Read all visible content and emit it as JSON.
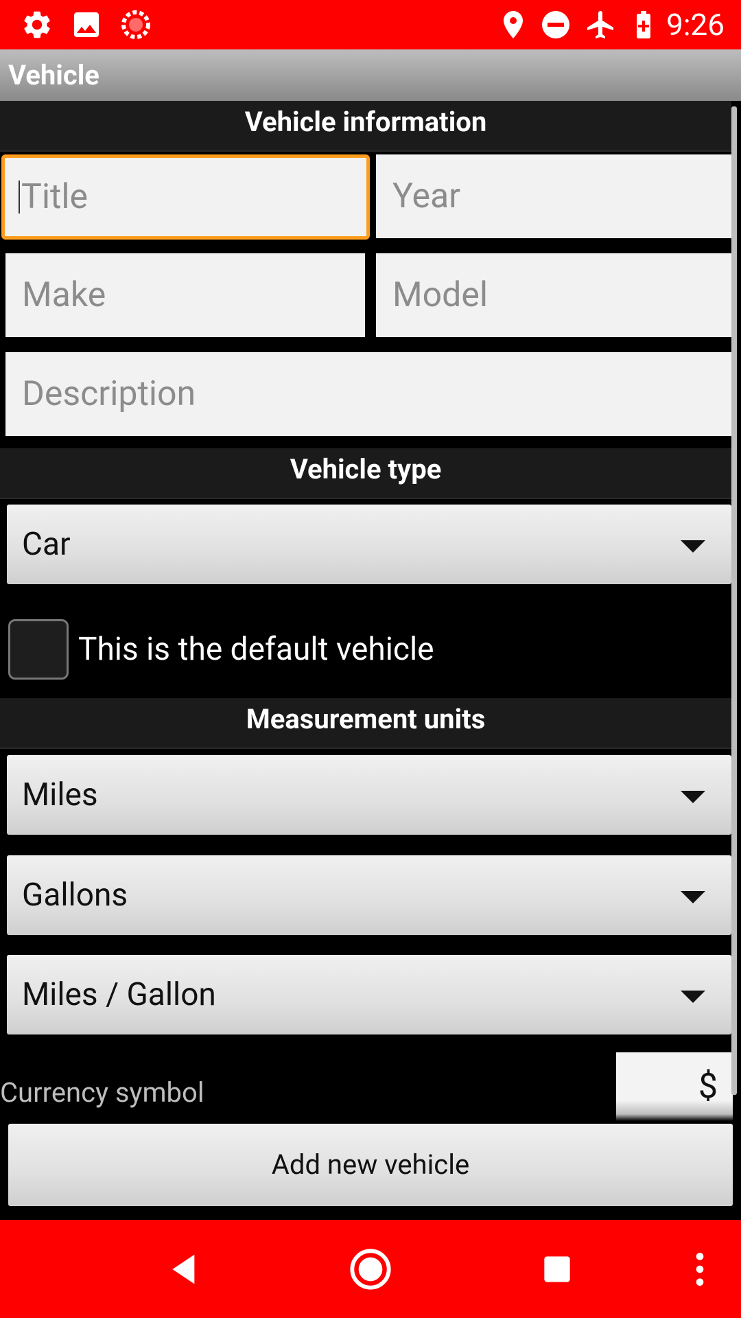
{
  "status_bar": {
    "time": "9:26",
    "left_icons": [
      "gear-icon",
      "image-icon",
      "sync-icon"
    ],
    "right_icons": [
      "location-icon",
      "do-not-disturb-icon",
      "airplane-icon",
      "battery-icon"
    ]
  },
  "app_bar": {
    "title": "Vehicle"
  },
  "sections": {
    "vehicle_information": "Vehicle information",
    "vehicle_type": "Vehicle type",
    "measurement_units": "Measurement units"
  },
  "fields": {
    "title": {
      "placeholder": "Title",
      "value": ""
    },
    "year": {
      "placeholder": "Year",
      "value": ""
    },
    "make": {
      "placeholder": "Make",
      "value": ""
    },
    "model": {
      "placeholder": "Model",
      "value": ""
    },
    "description": {
      "placeholder": "Description",
      "value": ""
    }
  },
  "vehicle_type": {
    "selected": "Car"
  },
  "default_vehicle": {
    "label": "This is the default vehicle",
    "checked": false
  },
  "units": {
    "distance": "Miles",
    "volume": "Gallons",
    "economy": "Miles / Gallon"
  },
  "currency": {
    "label": "Currency symbol",
    "value": "$"
  },
  "add_button": {
    "label": "Add new vehicle"
  },
  "colors": {
    "status_bar": "#ff0000",
    "nav_bar": "#ff0000",
    "focus_outline": "#ff9d1f"
  },
  "nav_bar": {
    "icons": [
      "back-icon",
      "home-icon",
      "recents-icon",
      "overflow-menu-icon"
    ]
  }
}
